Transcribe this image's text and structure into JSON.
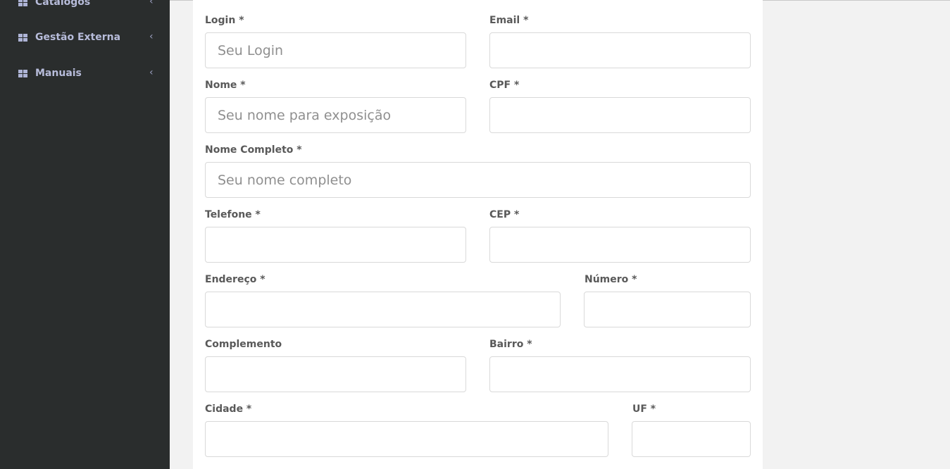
{
  "sidebar": {
    "items": [
      {
        "label": "Catalogos",
        "icon": "grid-icon"
      },
      {
        "label": "Gestão Externa",
        "icon": "grid-icon"
      },
      {
        "label": "Manuais",
        "icon": "grid-icon"
      }
    ]
  },
  "form": {
    "login": {
      "label": "Login *",
      "placeholder": "Seu Login",
      "value": ""
    },
    "email": {
      "label": "Email *",
      "placeholder": "",
      "value": ""
    },
    "nome": {
      "label": "Nome *",
      "placeholder": "Seu nome para exposição",
      "value": ""
    },
    "cpf": {
      "label": "CPF *",
      "placeholder": "",
      "value": ""
    },
    "nome_completo": {
      "label": "Nome Completo *",
      "placeholder": "Seu nome completo",
      "value": ""
    },
    "telefone": {
      "label": "Telefone *",
      "placeholder": "",
      "value": ""
    },
    "cep": {
      "label": "CEP *",
      "placeholder": "",
      "value": ""
    },
    "endereco": {
      "label": "Endereço *",
      "placeholder": "",
      "value": ""
    },
    "numero": {
      "label": "Número *",
      "placeholder": "",
      "value": ""
    },
    "complemento": {
      "label": "Complemento",
      "placeholder": "",
      "value": ""
    },
    "bairro": {
      "label": "Bairro *",
      "placeholder": "",
      "value": ""
    },
    "cidade": {
      "label": "Cidade *",
      "placeholder": "",
      "value": ""
    },
    "uf": {
      "label": "UF *",
      "placeholder": "",
      "value": ""
    }
  },
  "colors": {
    "sidebar_bg": "#2a2d2d",
    "sidebar_text": "#b7bcda",
    "page_bg": "#f2f2f2",
    "card_bg": "#ffffff",
    "label_text": "#595959",
    "input_border": "#d9d9d9"
  }
}
